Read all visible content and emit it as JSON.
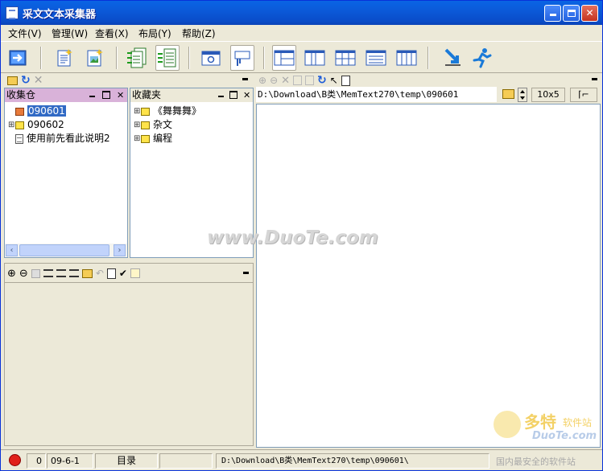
{
  "app": {
    "title": "采文文本采集器"
  },
  "menus": [
    "文件(V)",
    "管理(W)",
    "查看(X)",
    "布局(Y)",
    "帮助(Z)"
  ],
  "toolbar": {
    "icons": [
      "exit-icon",
      "new-doc-icon",
      "new-doc-image-icon",
      "collect-all-icon",
      "collect-icon",
      "window-capture-icon",
      "drag-capture-icon",
      "layout-1-icon",
      "layout-2-icon",
      "layout-3-icon",
      "layout-4-icon",
      "layout-5-icon",
      "download-icon",
      "run-icon"
    ]
  },
  "left_top": {
    "collection": {
      "title": "收集仓",
      "items": [
        {
          "label": "090601"
        },
        {
          "label": "090602"
        },
        {
          "label": "使用前先看此说明2"
        }
      ]
    },
    "favorites": {
      "title": "收藏夹",
      "items": [
        {
          "label": "《舞舞舞》"
        },
        {
          "label": "杂文"
        },
        {
          "label": "编程"
        }
      ]
    }
  },
  "right": {
    "path": "D:\\Download\\B类\\MemText270\\temp\\090601",
    "grid_size": "10x5"
  },
  "status": {
    "count": "0",
    "date": "09-6-1",
    "mode": "目录",
    "path": "D:\\Download\\B类\\MemText270\\temp\\090601\\"
  },
  "watermark": {
    "main": "www.DuoTe.com",
    "logo_line1": "多特",
    "logo_line2": "软件站",
    "logo_line3": "DuoTe.com",
    "slogan": "国内最安全的软件站"
  }
}
